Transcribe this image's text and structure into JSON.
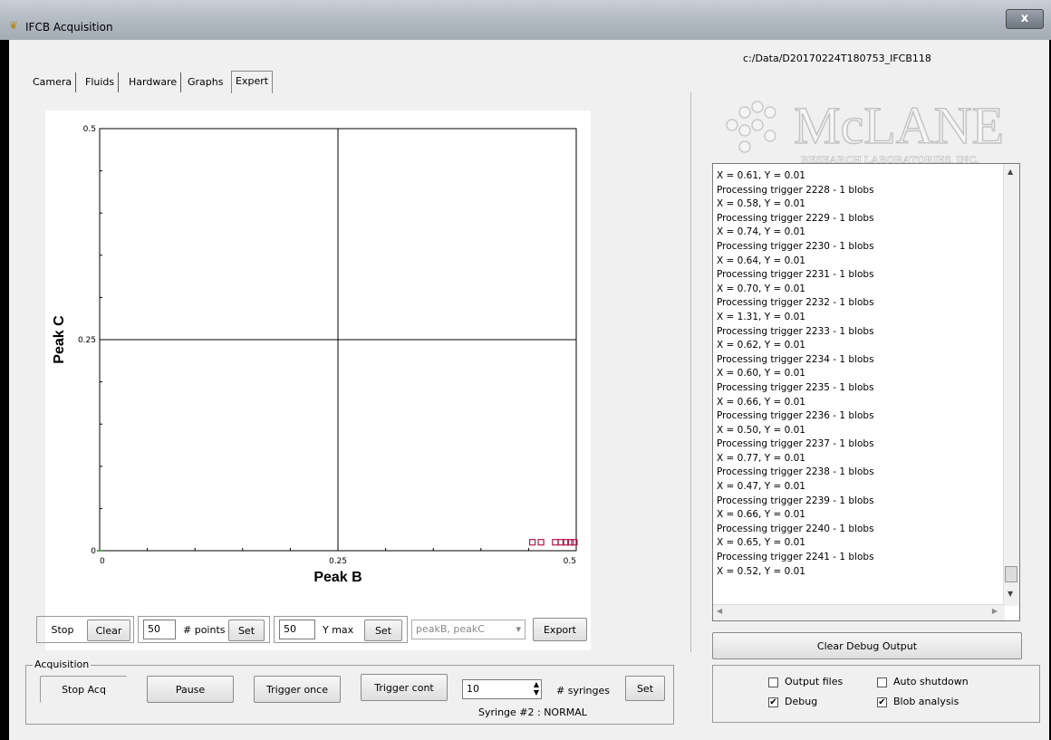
{
  "window": {
    "title": "IFCB Acquisition",
    "close_label": "x"
  },
  "tabs": [
    {
      "label": "Camera"
    },
    {
      "label": "Fluids"
    },
    {
      "label": "Hardware"
    },
    {
      "label": "Graphs"
    },
    {
      "label": "Expert"
    }
  ],
  "plot": {
    "x_ticks": [
      "0",
      "0.25",
      "0.5"
    ],
    "y_ticks": [
      "0.5",
      "0.25",
      "0"
    ],
    "xlabel": "Peak B",
    "ylabel": "Peak C",
    "marker_color": "#b0184a"
  },
  "chart_data": {
    "type": "scatter",
    "title": "",
    "xlabel": "Peak B",
    "ylabel": "Peak C",
    "xlim": [
      0,
      0.5
    ],
    "ylim": [
      0,
      0.5
    ],
    "grid": true,
    "series": [
      {
        "x": [
          0.454,
          0.463,
          0.478,
          0.484,
          0.489,
          0.494,
          0.498
        ],
        "y": [
          0.01,
          0.01,
          0.01,
          0.01,
          0.01,
          0.01,
          0.01
        ]
      }
    ]
  },
  "graph_controls": {
    "stop_label": "Stop",
    "clear_label": "Clear",
    "points_value": "50",
    "points_label": "# points",
    "set_points_label": "Set",
    "ymax_value": "50",
    "ymax_label": "Y max",
    "set_ymax_label": "Set",
    "series_select": "peakB, peakC",
    "export_label": "Export"
  },
  "acquisition": {
    "group_label": "Acquisition",
    "stop_acq_label": "Stop Acq",
    "pause_label": "Pause",
    "trigger_once_label": "Trigger once",
    "trigger_cont_label": "Trigger cont",
    "syringes_value": "10",
    "syringes_label": "# syringes",
    "set_label": "Set",
    "status": "Syringe #2 : NORMAL"
  },
  "right_panel": {
    "data_path": "c:/Data/D20170224T180753_IFCB118",
    "logo_main": "McLANE",
    "logo_sub": "RESEARCH LABORATORIES, INC.",
    "debug_lines": [
      "X = 0.61, Y = 0.01",
      "Processing trigger 2228 - 1 blobs",
      "X = 0.58, Y = 0.01",
      "Processing trigger 2229 - 1 blobs",
      "X = 0.74, Y = 0.01",
      "Processing trigger 2230 - 1 blobs",
      "X = 0.64, Y = 0.01",
      "Processing trigger 2231 - 1 blobs",
      "X = 0.70, Y = 0.01",
      "Processing trigger 2232 - 1 blobs",
      "X = 1.31, Y = 0.01",
      "Processing trigger 2233 - 1 blobs",
      "X = 0.62, Y = 0.01",
      "Processing trigger 2234 - 1 blobs",
      "X = 0.60, Y = 0.01",
      "Processing trigger 2235 - 1 blobs",
      "X = 0.66, Y = 0.01",
      "Processing trigger 2236 - 1 blobs",
      "X = 0.50, Y = 0.01",
      "Processing trigger 2237 - 1 blobs",
      "X = 0.77, Y = 0.01",
      "Processing trigger 2238 - 1 blobs",
      "X = 0.47, Y = 0.01",
      "Processing trigger 2239 - 1 blobs",
      "X = 0.66, Y = 0.01",
      "Processing trigger 2240 - 1 blobs",
      "X = 0.65, Y = 0.01",
      "Processing trigger 2241 - 1 blobs",
      "X = 0.52, Y = 0.01"
    ],
    "clear_debug_label": "Clear Debug Output",
    "options": {
      "output_files": {
        "label": "Output files",
        "checked": false
      },
      "auto_shutdown": {
        "label": "Auto shutdown",
        "checked": false
      },
      "debug": {
        "label": "Debug",
        "checked": true
      },
      "blob_analysis": {
        "label": "Blob analysis",
        "checked": true
      }
    }
  }
}
